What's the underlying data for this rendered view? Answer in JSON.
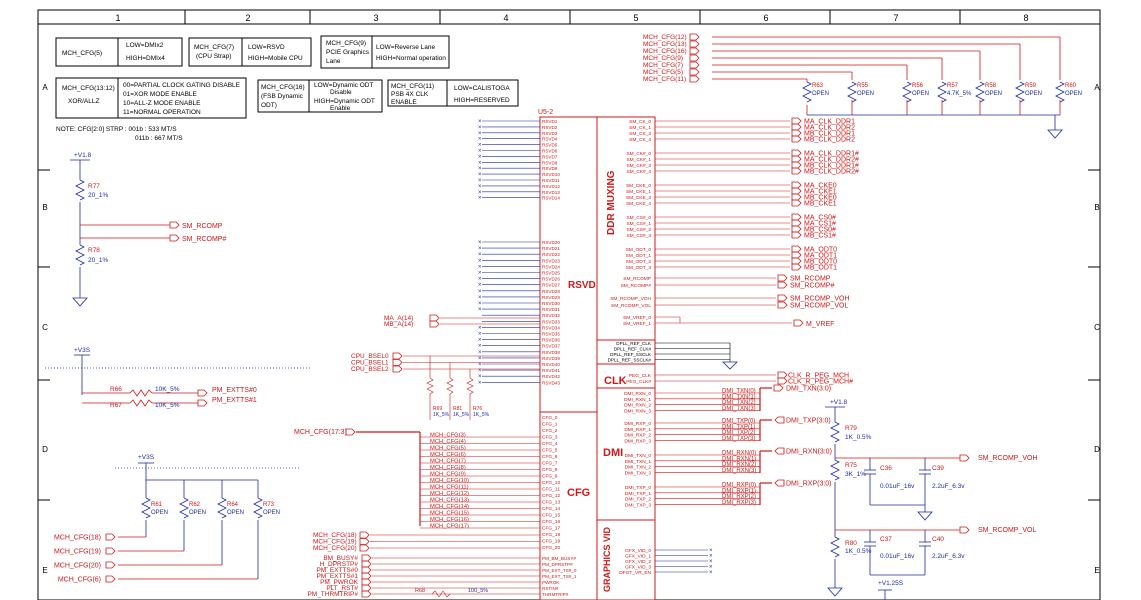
{
  "grid": {
    "cols": [
      "1",
      "2",
      "3",
      "4",
      "5",
      "6",
      "7",
      "8"
    ],
    "rows": [
      "A",
      "B",
      "C",
      "D",
      "E"
    ]
  },
  "notes": {
    "box1_name": "MCH_CFG(5)",
    "box1_low": "LOW=DMIx2",
    "box1_high": "HIGH=DMIx4",
    "box2_name": "MCH_CFG(7)",
    "box2_sub": "(CPU Strap)",
    "box2_low": "LOW=RSVD",
    "box2_high": "HIGH=Mobile CPU",
    "box3_name": "MCH_CFG(9)",
    "box3_sub1": "PCIE Graphics",
    "box3_sub2": "Lane",
    "box3_low": "LOW=Reverse Lane",
    "box3_high": "HIGH=Normal operation",
    "box4_name": "MCH_CFG(13:12)",
    "box4_sub": "XOR/ALLZ",
    "box4_l1": "00=PARTIAL CLOCK GATING DISABLE",
    "box4_l2": "01=XOR MODE ENABLE",
    "box4_l3": "10=ALL-Z MODE ENABLE",
    "box4_l4": "11=NORMAL OPERATION",
    "box5_name": "MCH_CFG(16)",
    "box5_sub1": "(FSB Dynamic",
    "box5_sub2": "ODT)",
    "box5_low1": "LOW=Dynamic ODT",
    "box5_low2": "Disable",
    "box5_high1": "HIGH=Dynamic ODT",
    "box5_high2": "Enable",
    "box6_name": "MCH_CFG(11)",
    "box6_sub1": "PSB 4X CLK",
    "box6_sub2": "ENABLE",
    "box6_low": "LOW=CALISTOGA",
    "box6_high": "HIGH=RESERVED",
    "strap_line1": "NOTE: CFG[2:0] STRP : 001b : 533 MT/S",
    "strap_line2": "011b : 667 MT/S"
  },
  "chip": {
    "ref": "U5-2",
    "sections": [
      "RSVD",
      "DDR MUXING",
      "CLK",
      "DMI",
      "CFG",
      "GRAPHICS VID"
    ]
  },
  "rsvd_pins": [
    "RSVD1",
    "RSVD2",
    "RSVD3",
    "RSVD4",
    "RSVD5",
    "RSVD6",
    "RSVD7",
    "RSVD8",
    "RSVD9",
    "RSVD10",
    "RSVD11",
    "RSVD12",
    "RSVD13",
    "RSVD14"
  ],
  "rsvd_pins2": [
    "RSVD20",
    "RSVD21",
    "RSVD22",
    "RSVD23",
    "RSVD24",
    "RSVD25",
    "RSVD26",
    "RSVD27",
    "RSVD28",
    "RSVD29",
    "RSVD30",
    "RSVD31",
    "RSVD32",
    "RSVD33",
    "RSVD34",
    "RSVD35",
    "RSVD36",
    "RSVD37",
    "RSVD38",
    "RSVD39",
    "RSVD40",
    "RSVD41",
    "RSVD42",
    "RSVD43"
  ],
  "cfg_pins": [
    "CFG_0",
    "CFG_1",
    "CFG_2",
    "CFG_3",
    "CFG_4",
    "CFG_5",
    "CFG_6",
    "CFG_7",
    "CFG_8",
    "CFG_9",
    "CFG_10",
    "CFG_11",
    "CFG_12",
    "CFG_13",
    "CFG_14",
    "CFG_15",
    "CFG_16",
    "CFG_17",
    "CFG_18",
    "CFG_19",
    "CFG_20"
  ],
  "cfg_nets": [
    "MCH_CFG(3)",
    "MCH_CFG(4)",
    "MCH_CFG(5)",
    "MCH_CFG(6)",
    "MCH_CFG(7)",
    "MCH_CFG(8)",
    "MCH_CFG(9)",
    "MCH_CFG(10)",
    "MCH_CFG(11)",
    "MCH_CFG(12)",
    "MCH_CFG(13)",
    "MCH_CFG(14)",
    "MCH_CFG(15)",
    "MCH_CFG(16)",
    "MCH_CFG(17)"
  ],
  "cfg_bus": "MCH_CFG(17:3)",
  "cfg_hi_nets": [
    "MCH_CFG(18)",
    "MCH_CFG(19)",
    "MCH_CFG(20)"
  ],
  "pm_nets": [
    "BM_BUSY#",
    "H_DPRSTP#",
    "PM_EXTTS#0",
    "PM_EXTTS#1",
    "PM_PWROK",
    "PLT_RST#",
    "PM_THRMTRIP#"
  ],
  "pm_pins": [
    "PM_BM_BUSY#",
    "PM_DPRSTP#",
    "PM_EXT_TS#_0",
    "PM_EXT_TS#_1",
    "PWROK",
    "RSTIN#",
    "THRMTRIP#"
  ],
  "ma": [
    "MA_A(14)",
    "MB_A(14)"
  ],
  "cpu_bsel": [
    "CPU_BSEL0",
    "CPU_BSEL1",
    "CPU_BSEL2"
  ],
  "top_cfg_nets": [
    "MCH_CFG(12)",
    "MCH_CFG(13)",
    "MCH_CFG(16)",
    "MCH_CFG(9)",
    "MCH_CFG(7)",
    "MCH_CFG(5)",
    "MCH_CFG(11)"
  ],
  "top_res": [
    {
      "ref": "R63",
      "val": "OPEN"
    },
    {
      "ref": "R55",
      "val": "OPEN"
    },
    {
      "ref": "R56",
      "val": "OPEN"
    },
    {
      "ref": "R57",
      "val": "4.7K_5%"
    },
    {
      "ref": "R58",
      "val": "OPEN"
    },
    {
      "ref": "R59",
      "val": "OPEN"
    },
    {
      "ref": "R60",
      "val": "OPEN"
    }
  ],
  "ddr_groups": [
    {
      "pins": [
        "SM_CK_0",
        "SM_CK_1",
        "SM_CK_3",
        "SM_CK_4"
      ],
      "nets": [
        "MA_CLK_DDR1",
        "MA_CLK_DDR2",
        "MB_CLK_DDR1",
        "MB_CLK_DDR2"
      ]
    },
    {
      "pins": [
        "SM_CK#_0",
        "SM_CK#_1",
        "SM_CK#_3",
        "SM_CK#_4"
      ],
      "nets": [
        "MA_CLK_DDR1#",
        "MA_CLK_DDR2#",
        "MB_CLK_DDR1#",
        "MB_CLK_DDR2#"
      ]
    },
    {
      "pins": [
        "SM_CKE_0",
        "SM_CKE_1",
        "SM_CKE_3",
        "SM_CKE_4"
      ],
      "nets": [
        "MA_CKE0",
        "MA_CKE1",
        "MB_CKE0",
        "MB_CKE1"
      ]
    },
    {
      "pins": [
        "SM_CS#_0",
        "SM_CS#_1",
        "SM_CS#_2",
        "SM_CS#_3"
      ],
      "nets": [
        "MA_CS0#",
        "MA_CS1#",
        "MB_CS0#",
        "MB_CS1#"
      ]
    },
    {
      "pins": [
        "SM_ODT_0",
        "SM_ODT_1",
        "SM_ODT_2",
        "SM_ODT_3"
      ],
      "nets": [
        "MA_ODT0",
        "MA_ODT1",
        "MB_ODT0",
        "MB_ODT1"
      ]
    }
  ],
  "smcomp": {
    "pins": [
      "SM_RCOMP",
      "SM_RCOMP#",
      "SM_RCOMP_VOH",
      "SM_RCOMP_VOL"
    ],
    "nets": [
      "SM_RCOMP",
      "SM_RCOMP#",
      "SM_RCOMP_VOH",
      "SM_RCOMP_VOL"
    ],
    "vref_pins": [
      "SM_VREF_0",
      "SM_VREF_1"
    ],
    "vref_net": "M_VREF"
  },
  "clk": {
    "dpll_pins": [
      "DPLL_REF_CLK",
      "DPLL_REF_CLK#",
      "DPLL_REF_SSCLK",
      "DPLL_REF_SSCLK#"
    ],
    "peg_pins": [
      "PEG_CLK",
      "PEG_CLK#"
    ],
    "peg_nets": [
      "CLK_R_PEG_MCH",
      "CLK_R_PEG_MCH#"
    ]
  },
  "dmi": {
    "rxn_pins": [
      "DMI_RXN_0",
      "DMI_RXN_1",
      "DMI_RXN_2",
      "DMI_RXN_3"
    ],
    "rxp_pins": [
      "DMI_RXP_0",
      "DMI_RXP_1",
      "DMI_RXP_2",
      "DMI_RXP_3"
    ],
    "txn_pins": [
      "DMI_TXN_0",
      "DMI_TXN_1",
      "DMI_TXN_2",
      "DMI_TXN_3"
    ],
    "txp_pins": [
      "DMI_TXP_0",
      "DMI_TXP_1",
      "DMI_TXP_2",
      "DMI_TXP_3"
    ],
    "txn_nets": [
      "DMI_TXN(0)",
      "DMI_TXN(1)",
      "DMI_TXN(2)",
      "DMI_TXN(3)"
    ],
    "txp_nets": [
      "DMI_TXP(0)",
      "DMI_TXP(1)",
      "DMI_TXP(2)",
      "DMI_TXP(3)"
    ],
    "rxn_nets": [
      "DMI_RXN(0)",
      "DMI_RXN(1)",
      "DMI_RXN(2)",
      "DMI_RXN(3)"
    ],
    "rxp_nets": [
      "DMI_RXP(0)",
      "DMI_RXP(1)",
      "DMI_RXP(2)",
      "DMI_RXP(3)"
    ],
    "bus_txn": "DMI_TXN(3:0)",
    "bus_txp": "DMI_TXP(3:0)",
    "bus_rxn": "DMI_RXN(3:0)",
    "bus_rxp": "DMI_RXP(3:0)"
  },
  "gfx_pins": [
    "GFX_VID_0",
    "GFX_VID_1",
    "GFX_VID_2",
    "GFX_VID_3",
    "DFGT_VR_EN"
  ],
  "left": {
    "v18": "+V1.8",
    "r77": "R77",
    "r77_val": "20_1%",
    "r78": "R78",
    "r78_val": "20_1%",
    "sm_rcomp": "SM_RCOMP",
    "sm_rcomp_n": "SM_RCOMP#",
    "v3s": "+V3S",
    "r66": "R66",
    "r67": "R67",
    "r_val": "10K_5%",
    "ext0": "PM_EXTTS#0",
    "ext1": "PM_EXTTS#1",
    "r68": "R68",
    "r68_val": "100_5%",
    "v3s2": "+V3S",
    "res_bank": [
      {
        "ref": "R61",
        "val": "OPEN"
      },
      {
        "ref": "R62",
        "val": "OPEN"
      },
      {
        "ref": "R64",
        "val": "OPEN"
      },
      {
        "ref": "R73",
        "val": "OPEN"
      }
    ],
    "bank_nets": [
      "MCH_CFG(18)",
      "MCH_CFG(19)",
      "MCH_CFG(20)",
      "MCH_CFG(6)"
    ],
    "bsel_res": [
      {
        "ref": "R69",
        "val": "1K_5%"
      },
      {
        "ref": "R81",
        "val": "1K_5%"
      },
      {
        "ref": "R76",
        "val": "1K_5%"
      }
    ]
  },
  "right": {
    "v18": "+V1.8",
    "r79": "R79",
    "r79_val": "1K_0.5%",
    "r75": "R75",
    "r75_val": "3K_1%",
    "r80": "R80",
    "r80_val": "1K_0.5%",
    "c36": "C36",
    "c36_val": "0.01uF_16v",
    "c39": "C39",
    "c39_val": "2.2uF_6.3v",
    "c37": "C37",
    "c37_val": "0.01uF_16v",
    "c40": "C40",
    "c40_val": "2.2uF_6.3v",
    "voh": "SM_RCOMP_VOH",
    "vol": "SM_RCOMP_VOL",
    "v125": "+V1.25S"
  }
}
